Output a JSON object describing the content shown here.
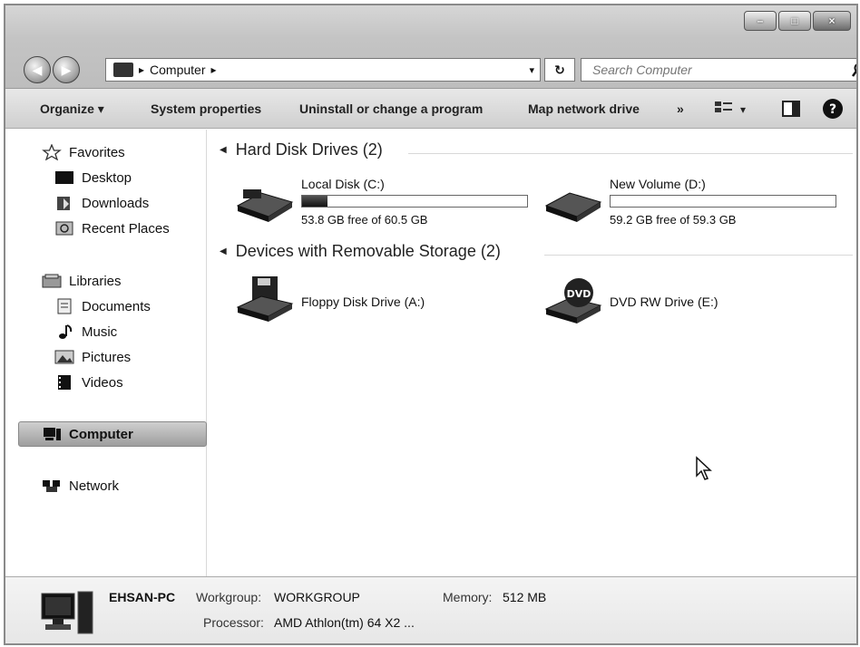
{
  "window": {
    "controls": [
      "–",
      "□",
      "×"
    ]
  },
  "nav": {
    "back_glyph": "◀",
    "forward_glyph": "▶",
    "breadcrumb_root": "Computer",
    "breadcrumb_separator": "▸",
    "address_dropdown_glyph": "▾",
    "refresh_glyph": "↻",
    "search_placeholder": "Search Computer"
  },
  "toolbar": {
    "organize": "Organize",
    "organize_arrow": "▾",
    "system_properties": "System properties",
    "uninstall": "Uninstall or change a program",
    "map_drive": "Map network drive",
    "more": "»",
    "views_arrow": "▾",
    "help": "?"
  },
  "sidebar": {
    "favorites": "Favorites",
    "favorites_items": [
      "Desktop",
      "Downloads",
      "Recent Places"
    ],
    "libraries": "Libraries",
    "libraries_items": [
      "Documents",
      "Music",
      "Pictures",
      "Videos"
    ],
    "computer": "Computer",
    "network": "Network"
  },
  "groups": {
    "hard_disks": {
      "title": "Hard Disk Drives (2)",
      "drives": [
        {
          "name": "Local Disk (C:)",
          "free_text": "53.8 GB free of 60.5 GB",
          "used_fraction": 0.111
        },
        {
          "name": "New Volume (D:)",
          "free_text": "59.2 GB free of 59.3 GB",
          "used_fraction": 0.002
        }
      ]
    },
    "removable": {
      "title": "Devices with Removable Storage (2)",
      "devices": [
        {
          "name": "Floppy Disk Drive (A:)"
        },
        {
          "name": "DVD RW Drive (E:)",
          "badge": "DVD"
        }
      ]
    }
  },
  "details": {
    "computer_name": "EHSAN-PC",
    "workgroup_label": "Workgroup:",
    "workgroup": "WORKGROUP",
    "memory_label": "Memory:",
    "memory": "512 MB",
    "processor_label": "Processor:",
    "processor": "AMD Athlon(tm) 64 X2 ..."
  },
  "colors": {
    "selection": "#a8a8a8",
    "bar_fill": "#222222"
  }
}
